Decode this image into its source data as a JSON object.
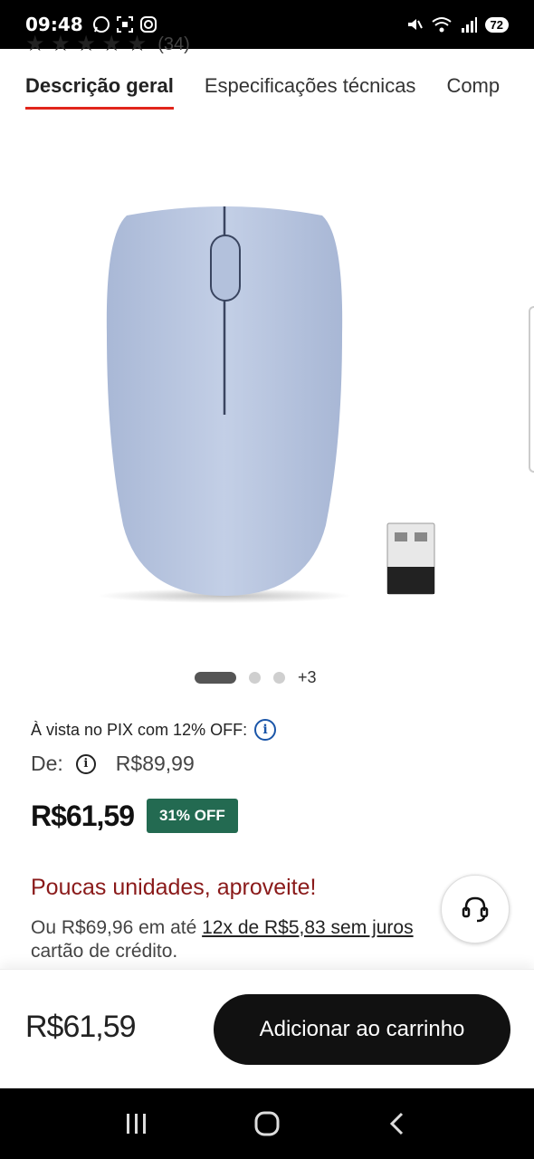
{
  "status_bar": {
    "time": "09:48",
    "battery": "72"
  },
  "rating": {
    "stars": "★ ★ ★ ★ ★",
    "count": "(34)"
  },
  "tabs": [
    {
      "label": "Descrição geral"
    },
    {
      "label": "Especificações técnicas"
    },
    {
      "label": "Compatibilidade"
    }
  ],
  "carousel": {
    "more_label": "+3",
    "active_index": 0,
    "dot_count": 3
  },
  "pricing": {
    "pix_text": "À vista no PIX com 12% OFF:",
    "from_label": "De:",
    "old_price": "R$89,99",
    "current_price": "R$61,59",
    "discount_badge": "31% OFF"
  },
  "stock": {
    "scarcity_text": "Poucas unidades, aproveite!"
  },
  "installments": {
    "prefix": "Ou R$69,96 em até ",
    "link": "12x de R$5,83 sem juros",
    "suffix": "cartão de crédito."
  },
  "bottom_bar": {
    "price": "R$61,59",
    "add_to_cart": "Adicionar ao carrinho"
  },
  "colors": {
    "accent_red": "#e1251b",
    "badge_green": "#236a51",
    "scarcity_red": "#8a1a1a",
    "info_blue": "#1a55a8",
    "mouse_color": "#b9c6e0"
  }
}
